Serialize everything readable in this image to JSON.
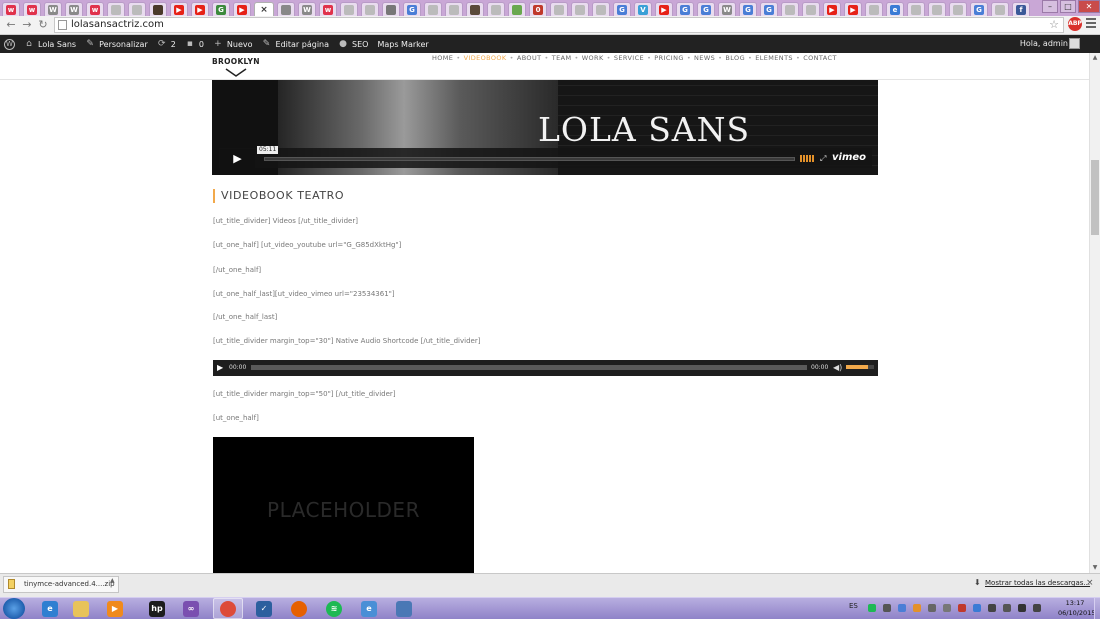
{
  "browser": {
    "url": "lolasansactriz.com",
    "active_tab_close": "×",
    "tabs": [
      {
        "icon": "w",
        "color": "#e0314b"
      },
      {
        "icon": "w",
        "color": "#e0314b"
      },
      {
        "icon": "W",
        "color": "#8a8a8a"
      },
      {
        "icon": "W",
        "color": "#8a8a8a"
      },
      {
        "icon": "w",
        "color": "#e0314b"
      },
      {
        "icon": "",
        "color": "#bbbbbb"
      },
      {
        "icon": "",
        "color": "#bbbbbb"
      },
      {
        "icon": "",
        "color": "#4a3a2a"
      },
      {
        "icon": "▶",
        "color": "#e62117"
      },
      {
        "icon": "▶",
        "color": "#e62117"
      },
      {
        "icon": "G",
        "color": "#3c8a3c"
      },
      {
        "icon": "▶",
        "color": "#e62117"
      }
    ],
    "right_tabs": [
      {
        "icon": "",
        "color": "#888888"
      },
      {
        "icon": "W",
        "color": "#8a8a8a"
      },
      {
        "icon": "w",
        "color": "#e0314b"
      },
      {
        "icon": "",
        "color": "#bbbbbb"
      },
      {
        "icon": "",
        "color": "#bbbbbb"
      },
      {
        "icon": "",
        "color": "#777777"
      },
      {
        "icon": "G",
        "color": "#4a7ed6"
      },
      {
        "icon": "",
        "color": "#bbbbbb"
      },
      {
        "icon": "",
        "color": "#bbbbbb"
      },
      {
        "icon": "",
        "color": "#5a4a3a"
      },
      {
        "icon": "",
        "color": "#bbbbbb"
      },
      {
        "icon": "",
        "color": "#6aa84f"
      },
      {
        "icon": "0",
        "color": "#c0392b"
      },
      {
        "icon": "",
        "color": "#bbbbbb"
      },
      {
        "icon": "",
        "color": "#bbbbbb"
      },
      {
        "icon": "",
        "color": "#bbbbbb"
      },
      {
        "icon": "G",
        "color": "#4a7ed6"
      },
      {
        "icon": "V",
        "color": "#3aa0d6"
      },
      {
        "icon": "▶",
        "color": "#e62117"
      },
      {
        "icon": "G",
        "color": "#4a7ed6"
      },
      {
        "icon": "G",
        "color": "#4a7ed6"
      },
      {
        "icon": "W",
        "color": "#8a8a8a"
      },
      {
        "icon": "G",
        "color": "#4a7ed6"
      },
      {
        "icon": "G",
        "color": "#4a7ed6"
      },
      {
        "icon": "",
        "color": "#bbbbbb"
      },
      {
        "icon": "",
        "color": "#bbbbbb"
      },
      {
        "icon": "▶",
        "color": "#e62117"
      },
      {
        "icon": "▶",
        "color": "#e62117"
      },
      {
        "icon": "",
        "color": "#bbbbbb"
      },
      {
        "icon": "e",
        "color": "#3a7bd5"
      },
      {
        "icon": "",
        "color": "#bbbbbb"
      },
      {
        "icon": "",
        "color": "#bbbbbb"
      },
      {
        "icon": "",
        "color": "#bbbbbb"
      },
      {
        "icon": "G",
        "color": "#4a7ed6"
      },
      {
        "icon": "",
        "color": "#bbbbbb"
      },
      {
        "icon": "f",
        "color": "#3b5998"
      }
    ],
    "abp_label": "ABP"
  },
  "wpadmin": {
    "items": [
      {
        "icon": "⌂",
        "label": "Lola Sans"
      },
      {
        "icon": "✎",
        "label": "Personalizar"
      },
      {
        "icon": "⟳",
        "label": "2"
      },
      {
        "icon": "▪",
        "label": "0"
      },
      {
        "icon": "+",
        "label": "Nuevo"
      },
      {
        "icon": "✎",
        "label": "Editar página"
      },
      {
        "icon": "●",
        "label": "SEO"
      },
      {
        "icon": "",
        "label": "Maps Marker"
      }
    ],
    "greeting": "Hola, admin"
  },
  "site": {
    "logo": "BROOKLYN",
    "nav": [
      {
        "label": "HOME",
        "active": false
      },
      {
        "label": "VIDEOBOOK",
        "active": true
      },
      {
        "label": "ABOUT",
        "active": false
      },
      {
        "label": "TEAM",
        "active": false
      },
      {
        "label": "WORK",
        "active": false
      },
      {
        "label": "SERVICE",
        "active": false
      },
      {
        "label": "PRICING",
        "active": false
      },
      {
        "label": "NEWS",
        "active": false
      },
      {
        "label": "BLOG",
        "active": false
      },
      {
        "label": "ELEMENTS",
        "active": false
      },
      {
        "label": "CONTACT",
        "active": false
      }
    ],
    "nav_separator": "•",
    "accent": "#f2a94b"
  },
  "hero": {
    "title": "LOLA SANS",
    "timecode": "05:11",
    "provider": "vimeo"
  },
  "content": {
    "section_title": "VIDEOBOOK TEATRO",
    "shortcodes": [
      "[ut_title_divider] Videos [/ut_title_divider]",
      "[ut_one_half] [ut_video_youtube url=\"G_G85dXktHg\"]",
      "[/ut_one_half]",
      "[ut_one_half_last][ut_video_vimeo url=\"23534361\"]",
      "[/ut_one_half_last]",
      "[ut_title_divider margin_top=\"30\"] Native Audio Shortcode [/ut_title_divider]"
    ],
    "shortcodes_after": [
      "[ut_title_divider margin_top=\"50\"]  [/ut_title_divider]",
      "[ut_one_half]"
    ],
    "audio": {
      "start": "00:00",
      "end": "00:00",
      "volume_level": 0.8
    },
    "placeholder": "PLACEHOLDER"
  },
  "downloads": {
    "file": "tinymce-advanced.4....zip",
    "show_all": "Mostrar todas las descargas..."
  },
  "taskbar": {
    "apps": [
      {
        "icon": "ie-icon",
        "glyph": "e",
        "color": "#2f7fd1"
      },
      {
        "icon": "folder-icon",
        "glyph": "",
        "color": "#e8c35a"
      },
      {
        "icon": "media-player-icon",
        "glyph": "▶",
        "color": "#f08a1c"
      },
      {
        "icon": "hp-icon",
        "glyph": "hp",
        "color": "#1c1c1c"
      },
      {
        "icon": "visual-studio-icon",
        "glyph": "∞",
        "color": "#7a4fb0"
      },
      {
        "icon": "chrome-icon",
        "glyph": "",
        "color": "#dd4b39"
      },
      {
        "icon": "app-check-icon",
        "glyph": "✓",
        "color": "#2c5f9e"
      },
      {
        "icon": "firefox-icon",
        "glyph": "",
        "color": "#e66000"
      },
      {
        "icon": "spotify-icon",
        "glyph": "≋",
        "color": "#1db954"
      },
      {
        "icon": "ie-alt-icon",
        "glyph": "e",
        "color": "#4a8fd6"
      },
      {
        "icon": "window-icon",
        "glyph": "",
        "color": "#4a78b5"
      }
    ],
    "lang": "ES",
    "time": "13:17",
    "date": "06/10/2015"
  }
}
